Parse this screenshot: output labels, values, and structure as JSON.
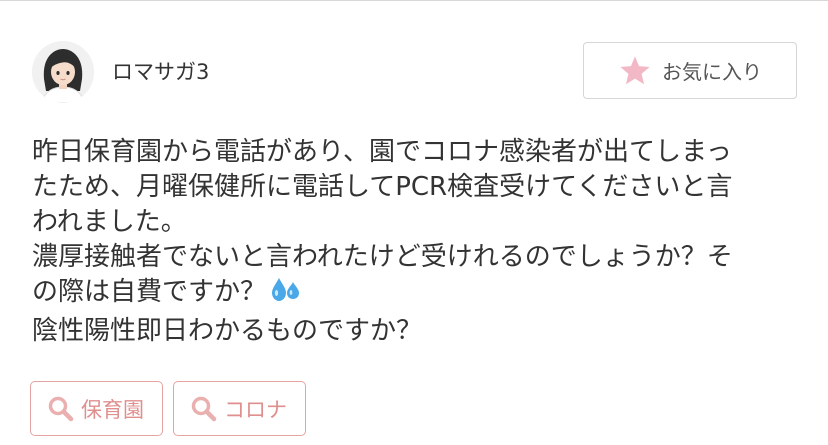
{
  "post": {
    "username": "ロマサガ3",
    "favorite_label": "お気に入り",
    "lines": [
      "昨日保育園から電話があり、園でコロナ感染者が出てしまっ",
      "たため、月曜保健所に電話してPCR検査受けてくださいと言",
      "われました。",
      "濃厚接触者でないと言われたけど受けれるのでしょうか？そ",
      "の際は自費ですか？",
      "陰性陽性即日わかるものですか？"
    ],
    "tags": [
      "保育園",
      "コロナ"
    ]
  },
  "icons": {
    "avatar": "avatar-woman-icon",
    "favorite": "star-icon",
    "emoji": "sweat-droplets-icon",
    "tag": "search-icon"
  },
  "colors": {
    "star": "#f2b8c6",
    "tag_border": "#e6a3a3",
    "tag_text": "#e08f8f",
    "sweat": "#4aa8e8"
  }
}
